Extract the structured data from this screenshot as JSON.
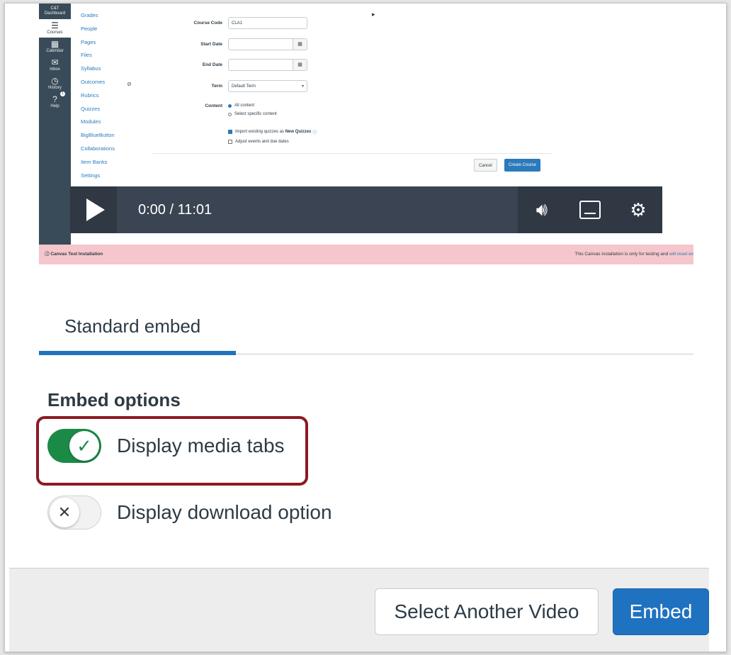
{
  "video": {
    "canvas_nav": [
      {
        "label": "Dashboard",
        "icon": "dashboard-icon",
        "glyph": "▤"
      },
      {
        "label": "Courses",
        "icon": "courses-icon",
        "glyph": "☰"
      },
      {
        "label": "Calendar",
        "icon": "calendar-icon",
        "glyph": "▦"
      },
      {
        "label": "Inbox",
        "icon": "inbox-icon",
        "glyph": "✉"
      },
      {
        "label": "History",
        "icon": "history-icon",
        "glyph": "◷"
      },
      {
        "label": "Help",
        "icon": "help-icon",
        "glyph": "?"
      }
    ],
    "dashboard_top": "C&T",
    "help_badge": "1",
    "course_nav": [
      "Grades",
      "People",
      "Pages",
      "Files",
      "Syllabus",
      "Outcomes",
      "Rubrics",
      "Quizzes",
      "Modules",
      "BigBlueButton",
      "Collaborations",
      "Item Banks",
      "Settings"
    ],
    "form": {
      "course_code_label": "Course Code",
      "course_code_value": "CLA1",
      "start_date_label": "Start Date",
      "end_date_label": "End Date",
      "term_label": "Term",
      "term_value": "Default Term",
      "content_label": "Content",
      "radio_all": "All content",
      "radio_specific": "Select specific content",
      "check_import": "Import existing quizzes as",
      "check_import_bold": "New Quizzes",
      "check_adjust": "Adjust events and due dates",
      "cancel": "Cancel",
      "create": "Create Course"
    },
    "player": {
      "time": "0:00 / 11:01"
    },
    "banner": {
      "left": "Canvas Test Installation",
      "right": "This Canvas installation is only for testing and",
      "right_link": "will reset ev"
    }
  },
  "tabs": [
    {
      "label": "Standard embed",
      "active": true
    }
  ],
  "embed_options": {
    "heading": "Embed options",
    "options": [
      {
        "label": "Display media tabs",
        "enabled": true
      },
      {
        "label": "Display download option",
        "enabled": false
      }
    ]
  },
  "footer": {
    "select_another": "Select Another Video",
    "embed": "Embed"
  },
  "colors": {
    "primary": "#1f72c0",
    "toggle_on": "#1b8a46",
    "highlight": "#8b1a22",
    "banner": "#f5c6cb"
  }
}
